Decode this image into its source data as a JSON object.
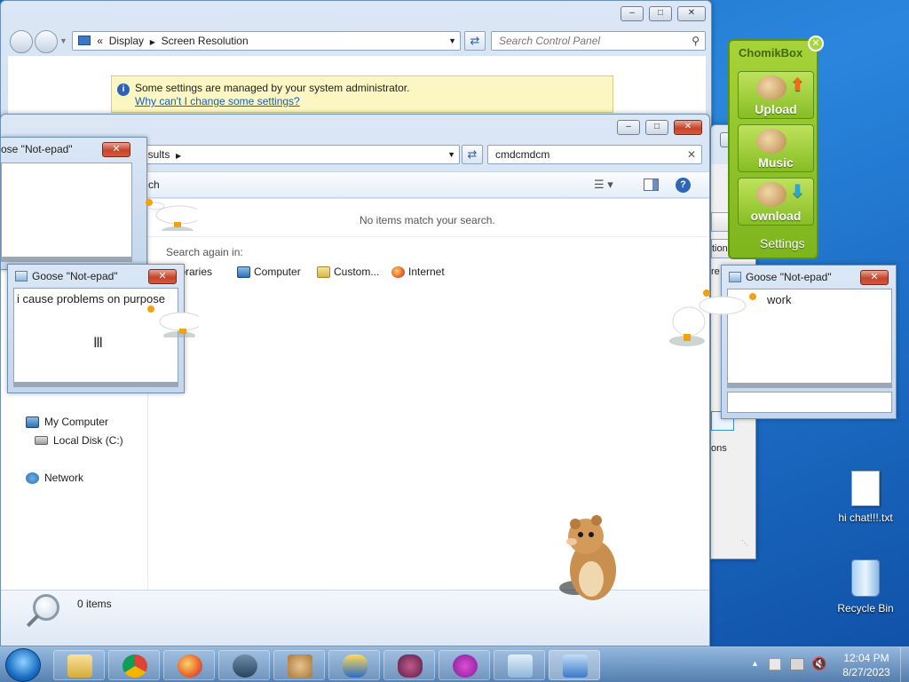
{
  "control_panel": {
    "breadcrumb_prefix": "«",
    "breadcrumb": [
      "Display",
      "Screen Resolution"
    ],
    "search_placeholder": "Search Control Panel",
    "info_message": "Some settings are managed by your system administrator.",
    "info_link": "Why can't I change some settings?"
  },
  "explorer": {
    "breadcrumb_partial": "esults",
    "search_value": "cmdcmdcm",
    "toolbar_partial": "ch",
    "no_items": "No items match your search.",
    "search_again_label": "Search again in:",
    "search_locations": [
      "Libraries",
      "Computer",
      "Custom...",
      "Internet"
    ],
    "nav": {
      "my_computer": "My Computer",
      "local_disk": "Local Disk (C:)",
      "network": "Network"
    },
    "status": "0 items"
  },
  "settings_partial": {
    "label1": "tion",
    "label2": "re",
    "label3": "ons"
  },
  "goose_windows": [
    {
      "title": "ose \"Not-epad\"",
      "text": ""
    },
    {
      "title": "Goose \"Not-epad\"",
      "text": "i cause problems on purpose"
    },
    {
      "title": "Goose \"Not-epad\"",
      "text": "work"
    }
  ],
  "chomikbox": {
    "title": "ChomikBox",
    "buttons": [
      "Upload",
      "Music",
      "ownload"
    ],
    "settings": "Settings"
  },
  "desktop": {
    "icons": [
      {
        "label": "hi chat!!!.txt",
        "icon": "text-file-icon"
      },
      {
        "label": "Recycle Bin",
        "icon": "recycle-bin-icon"
      }
    ]
  },
  "taskbar": {
    "time": "12:04 PM",
    "date": "8/27/2023"
  },
  "colors": {
    "desktop": "#1f70c8",
    "chomik_green": "#86bd24",
    "info_yellow": "#fbf6c2"
  }
}
